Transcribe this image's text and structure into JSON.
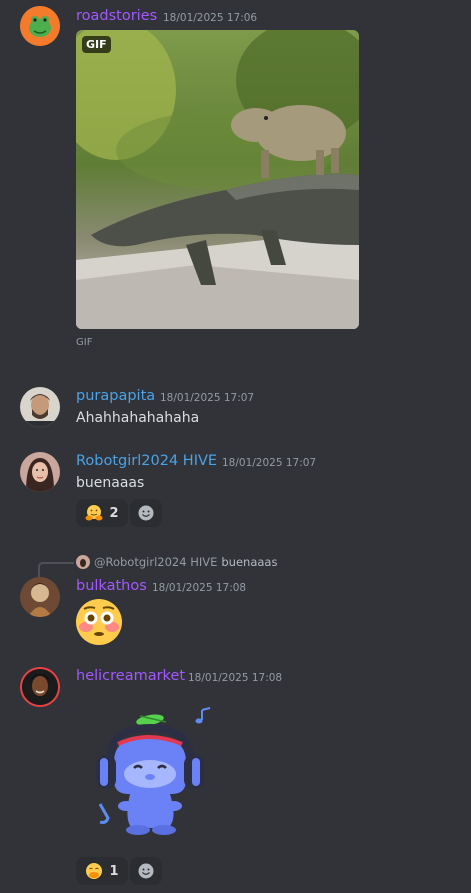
{
  "messages": [
    {
      "username": "roadstories",
      "timestamp": "18/01/2025 17:06",
      "media_badge": "GIF",
      "media_caption": "GIF",
      "name_color": "#a259ff"
    },
    {
      "username": "purapapita",
      "timestamp": "18/01/2025 17:07",
      "text": "Ahahhahahahaha",
      "name_color": "#4aa3e8"
    },
    {
      "username": "Robotgirl2024 HIVE",
      "timestamp": "18/01/2025 17:07",
      "text": "buenaaas",
      "name_color": "#4aa3e8",
      "reactions": [
        {
          "emoji_icon": "hugging-face-emoji",
          "count": "2"
        }
      ]
    },
    {
      "username": "bulkathos",
      "timestamp": "18/01/2025 17:08",
      "name_color": "#a259ff",
      "reply": {
        "mention": "@Robotgirl2024 HIVE",
        "text": "buenaaas"
      },
      "emoji_icon": "flushed-face-emoji"
    },
    {
      "username": "helicreamarket",
      "timestamp": "18/01/2025 17:08",
      "name_color": "#a259ff",
      "sticker": "discord-wumpus-headphones-sticker",
      "reactions": [
        {
          "emoji_icon": "face-with-hand-over-mouth-emoji",
          "count": "1"
        }
      ]
    }
  ],
  "colors": {
    "background": "#313338",
    "timestamp": "#949ba4",
    "text": "#dbdee1",
    "reaction_bg": "#2b2d31"
  }
}
